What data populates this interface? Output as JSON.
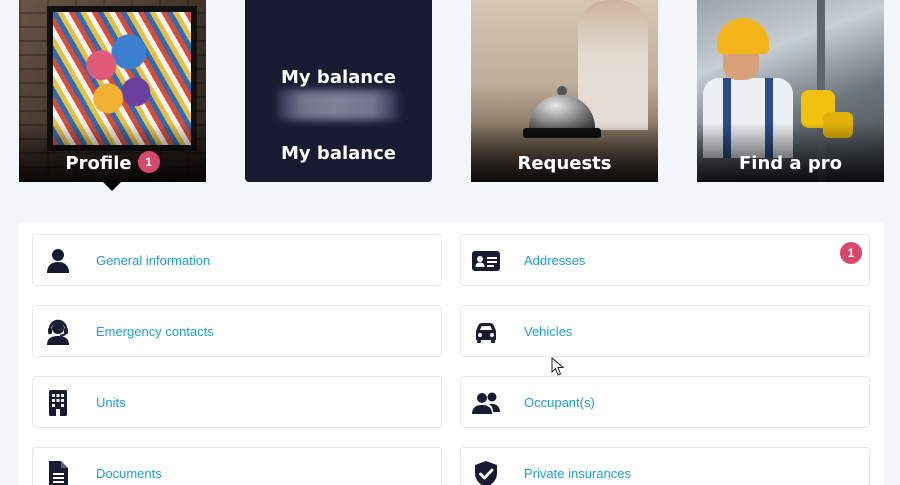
{
  "tiles": {
    "profile": {
      "label": "Profile",
      "badge": "1"
    },
    "balance": {
      "title_top": "My balance",
      "title_bottom": "My balance"
    },
    "requests": {
      "label": "Requests"
    },
    "find_pro": {
      "label": "Find a pro"
    }
  },
  "profile_items": {
    "general_information": "General information",
    "addresses": "Addresses",
    "addresses_badge": "1",
    "emergency_contacts": "Emergency contacts",
    "vehicles": "Vehicles",
    "units": "Units",
    "occupants": "Occupant(s)",
    "documents": "Documents",
    "private_insurances": "Private insurances"
  },
  "colors": {
    "link": "#1e9fd8",
    "icon": "#191b33",
    "badge": "#d9486a",
    "balance_tile": "#191b33"
  },
  "icons": {
    "general_information": "user-icon",
    "addresses": "id-card-icon",
    "emergency_contacts": "headset-user-icon",
    "vehicles": "car-icon",
    "units": "building-icon",
    "occupants": "users-icon",
    "documents": "file-icon",
    "private_insurances": "shield-check-icon"
  }
}
